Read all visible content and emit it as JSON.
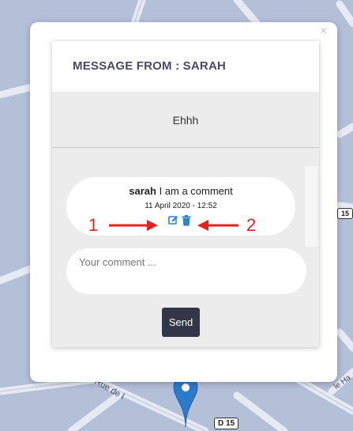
{
  "popup": {
    "close_symbol": "×",
    "title": "MESSAGE FROM : SARAH",
    "message": "Ehhh"
  },
  "comment": {
    "author": "sarah",
    "text": "I am a comment",
    "date": "11 April 2020 - 12:52",
    "edit_icon": "edit-icon",
    "delete_icon": "trash-icon"
  },
  "annotations": {
    "left_number": "1",
    "right_number": "2",
    "color": "#e52222"
  },
  "comment_input": {
    "placeholder": "Your comment ..."
  },
  "send_label": "Send",
  "map": {
    "labels": {
      "street": "Rue de l",
      "road_d15": "D 15",
      "road_15": "15",
      "corner_right": "le Ha"
    },
    "marker_icon": "map-pin-icon",
    "marker_color": "#2b7bcc"
  },
  "colors": {
    "title": "#4a4a68",
    "send_button": "#333646",
    "card_bg": "#ececec"
  }
}
